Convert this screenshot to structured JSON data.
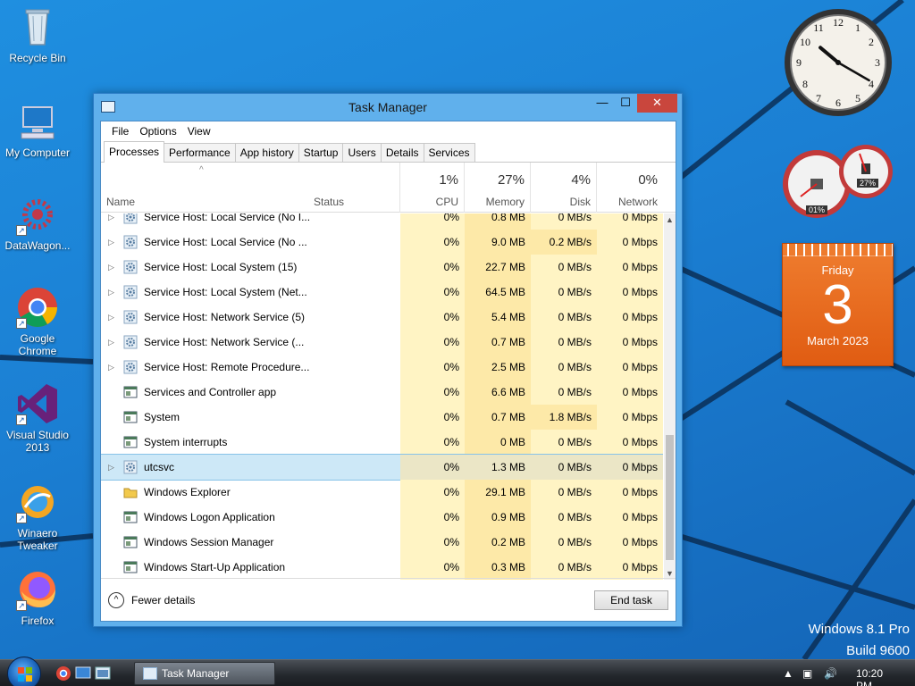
{
  "desktop": {
    "icons": [
      {
        "label": "Recycle Bin",
        "icon": "recycle-bin-icon"
      },
      {
        "label": "My Computer",
        "icon": "computer-icon"
      },
      {
        "label": "DataWagon...",
        "icon": "datawagon-icon"
      },
      {
        "label": "Google Chrome",
        "icon": "chrome-icon"
      },
      {
        "label": "Visual Studio 2013",
        "icon": "visual-studio-icon"
      },
      {
        "label": "Winaero Tweaker",
        "icon": "winaero-icon"
      },
      {
        "label": "Firefox",
        "icon": "firefox-icon"
      }
    ],
    "watermark_line1": "Windows 8.1 Pro",
    "watermark_line2": "Build 9600"
  },
  "gadgets": {
    "clock": {
      "hour": 10,
      "minute": 20
    },
    "meter": {
      "cpu": "01%",
      "memory": "27%"
    },
    "calendar": {
      "weekday": "Friday",
      "day": "3",
      "month_year": "March 2023"
    }
  },
  "window": {
    "title": "Task Manager",
    "menu": [
      "File",
      "Options",
      "View"
    ],
    "tabs": [
      "Processes",
      "Performance",
      "App history",
      "Startup",
      "Users",
      "Details",
      "Services"
    ],
    "active_tab": "Processes",
    "columns": {
      "name": "Name",
      "status": "Status",
      "cpu": {
        "pct": "1%",
        "label": "CPU"
      },
      "memory": {
        "pct": "27%",
        "label": "Memory"
      },
      "disk": {
        "pct": "4%",
        "label": "Disk"
      },
      "network": {
        "pct": "0%",
        "label": "Network"
      }
    },
    "rows": [
      {
        "name": "Service Host: Local Service (No I...",
        "expandable": true,
        "icon": "gear",
        "cpu": "0%",
        "memory": "0.8 MB",
        "disk": "0 MB/s",
        "network": "0 Mbps"
      },
      {
        "name": "Service Host: Local Service (No ...",
        "expandable": true,
        "icon": "gear",
        "cpu": "0%",
        "memory": "9.0 MB",
        "disk": "0.2 MB/s",
        "network": "0 Mbps"
      },
      {
        "name": "Service Host: Local System (15)",
        "expandable": true,
        "icon": "gear",
        "cpu": "0%",
        "memory": "22.7 MB",
        "disk": "0 MB/s",
        "network": "0 Mbps"
      },
      {
        "name": "Service Host: Local System (Net...",
        "expandable": true,
        "icon": "gear",
        "cpu": "0%",
        "memory": "64.5 MB",
        "disk": "0 MB/s",
        "network": "0 Mbps"
      },
      {
        "name": "Service Host: Network Service (5)",
        "expandable": true,
        "icon": "gear",
        "cpu": "0%",
        "memory": "5.4 MB",
        "disk": "0 MB/s",
        "network": "0 Mbps"
      },
      {
        "name": "Service Host: Network Service (...",
        "expandable": true,
        "icon": "gear",
        "cpu": "0%",
        "memory": "0.7 MB",
        "disk": "0 MB/s",
        "network": "0 Mbps"
      },
      {
        "name": "Service Host: Remote Procedure...",
        "expandable": true,
        "icon": "gear",
        "cpu": "0%",
        "memory": "2.5 MB",
        "disk": "0 MB/s",
        "network": "0 Mbps"
      },
      {
        "name": "Services and Controller app",
        "expandable": false,
        "icon": "app",
        "cpu": "0%",
        "memory": "6.6 MB",
        "disk": "0 MB/s",
        "network": "0 Mbps"
      },
      {
        "name": "System",
        "expandable": false,
        "icon": "app",
        "cpu": "0%",
        "memory": "0.7 MB",
        "disk": "1.8 MB/s",
        "network": "0 Mbps"
      },
      {
        "name": "System interrupts",
        "expandable": false,
        "icon": "app",
        "cpu": "0%",
        "memory": "0 MB",
        "disk": "0 MB/s",
        "network": "0 Mbps"
      },
      {
        "name": "utcsvc",
        "expandable": true,
        "icon": "gear",
        "cpu": "0%",
        "memory": "1.3 MB",
        "disk": "0 MB/s",
        "network": "0 Mbps",
        "selected": true
      },
      {
        "name": "Windows Explorer",
        "expandable": false,
        "icon": "folder",
        "cpu": "0%",
        "memory": "29.1 MB",
        "disk": "0 MB/s",
        "network": "0 Mbps"
      },
      {
        "name": "Windows Logon Application",
        "expandable": false,
        "icon": "app",
        "cpu": "0%",
        "memory": "0.9 MB",
        "disk": "0 MB/s",
        "network": "0 Mbps"
      },
      {
        "name": "Windows Session Manager",
        "expandable": false,
        "icon": "app",
        "cpu": "0%",
        "memory": "0.2 MB",
        "disk": "0 MB/s",
        "network": "0 Mbps"
      },
      {
        "name": "Windows Start-Up Application",
        "expandable": false,
        "icon": "app",
        "cpu": "0%",
        "memory": "0.3 MB",
        "disk": "0 MB/s",
        "network": "0 Mbps"
      }
    ],
    "fewer_details": "Fewer details",
    "end_task": "End task"
  },
  "taskbar": {
    "task_label": "Task Manager",
    "time": "10:20 PM"
  }
}
